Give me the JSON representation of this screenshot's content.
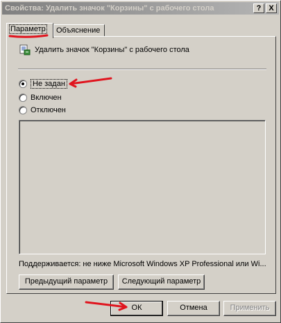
{
  "window": {
    "title": "Свойства: Удалить значок \"Корзины\" с рабочего стола",
    "help_button": "?",
    "close_button": "X"
  },
  "tabs": [
    {
      "label": "Параметр",
      "active": true
    },
    {
      "label": "Объяснение",
      "active": false
    }
  ],
  "policy": {
    "name": "Удалить значок \"Корзины\" с рабочего стола",
    "icon": "policy-icon"
  },
  "options": [
    {
      "label": "Не задан",
      "checked": true
    },
    {
      "label": "Включен",
      "checked": false
    },
    {
      "label": "Отключен",
      "checked": false
    }
  ],
  "supported_text": "Поддерживается:  не ниже Microsoft Windows XP Professional или Wi...",
  "nav_buttons": {
    "previous": "Предыдущий параметр",
    "next": "Следующий параметр"
  },
  "dialog_buttons": {
    "ok": "ОК",
    "cancel": "Отмена",
    "apply": "Применить"
  },
  "colors": {
    "dialog_bg": "#d4d0c8",
    "annotation_red": "#e0141e",
    "titlebar_inactive": "#808080"
  }
}
